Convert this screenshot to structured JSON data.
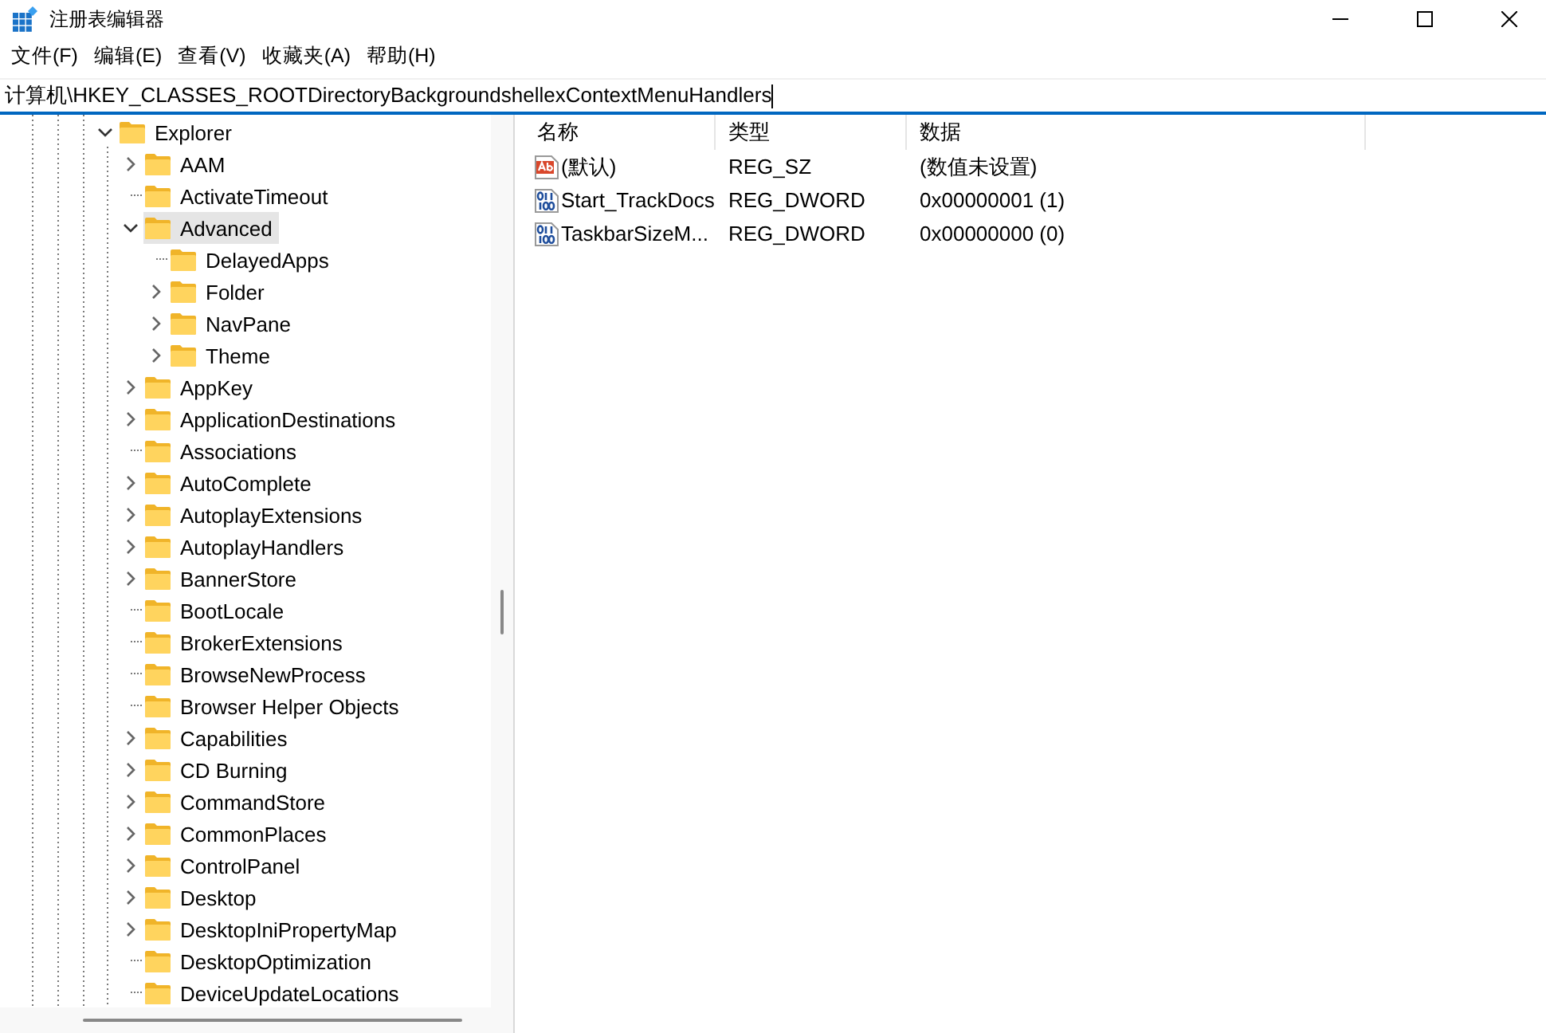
{
  "window": {
    "title": "注册表编辑器"
  },
  "menu": [
    "文件(F)",
    "编辑(E)",
    "查看(V)",
    "收藏夹(A)",
    "帮助(H)"
  ],
  "address": {
    "value": "计算机\\HKEY_CLASSES_ROOTDirectoryBackgroundshellexContextMenuHandlers"
  },
  "tree": [
    {
      "label": "Explorer",
      "expanded": true,
      "selected": false,
      "children": [
        {
          "label": "AAM",
          "expanded": false,
          "selected": false
        },
        {
          "label": "ActivateTimeout",
          "selected": false
        },
        {
          "label": "Advanced",
          "expanded": true,
          "selected": true,
          "children": [
            {
              "label": "DelayedApps",
              "selected": false
            },
            {
              "label": "Folder",
              "expanded": false,
              "selected": false
            },
            {
              "label": "NavPane",
              "expanded": false,
              "selected": false
            },
            {
              "label": "Theme",
              "expanded": false,
              "selected": false
            }
          ]
        },
        {
          "label": "AppKey",
          "expanded": false,
          "selected": false
        },
        {
          "label": "ApplicationDestinations",
          "expanded": false,
          "selected": false
        },
        {
          "label": "Associations",
          "selected": false
        },
        {
          "label": "AutoComplete",
          "expanded": false,
          "selected": false
        },
        {
          "label": "AutoplayExtensions",
          "expanded": false,
          "selected": false
        },
        {
          "label": "AutoplayHandlers",
          "expanded": false,
          "selected": false
        },
        {
          "label": "BannerStore",
          "expanded": false,
          "selected": false
        },
        {
          "label": "BootLocale",
          "selected": false
        },
        {
          "label": "BrokerExtensions",
          "selected": false
        },
        {
          "label": "BrowseNewProcess",
          "selected": false
        },
        {
          "label": "Browser Helper Objects",
          "selected": false
        },
        {
          "label": "Capabilities",
          "expanded": false,
          "selected": false
        },
        {
          "label": "CD Burning",
          "expanded": false,
          "selected": false
        },
        {
          "label": "CommandStore",
          "expanded": false,
          "selected": false
        },
        {
          "label": "CommonPlaces",
          "expanded": false,
          "selected": false
        },
        {
          "label": "ControlPanel",
          "expanded": false,
          "selected": false
        },
        {
          "label": "Desktop",
          "expanded": false,
          "selected": false
        },
        {
          "label": "DesktopIniPropertyMap",
          "expanded": false,
          "selected": false
        },
        {
          "label": "DesktopOptimization",
          "selected": false
        },
        {
          "label": "DeviceUpdateLocations",
          "selected": false
        }
      ]
    }
  ],
  "table": {
    "columns": [
      "名称",
      "类型",
      "数据"
    ],
    "rows": [
      {
        "kind": "string",
        "name": "(默认)",
        "type": "REG_SZ",
        "data": "(数值未设置)"
      },
      {
        "kind": "binary",
        "name": "Start_TrackDocs",
        "type": "REG_DWORD",
        "data": "0x00000001 (1)"
      },
      {
        "kind": "binary",
        "name": "TaskbarSizeM...",
        "type": "REG_DWORD",
        "data": "0x00000000 (0)"
      }
    ]
  }
}
